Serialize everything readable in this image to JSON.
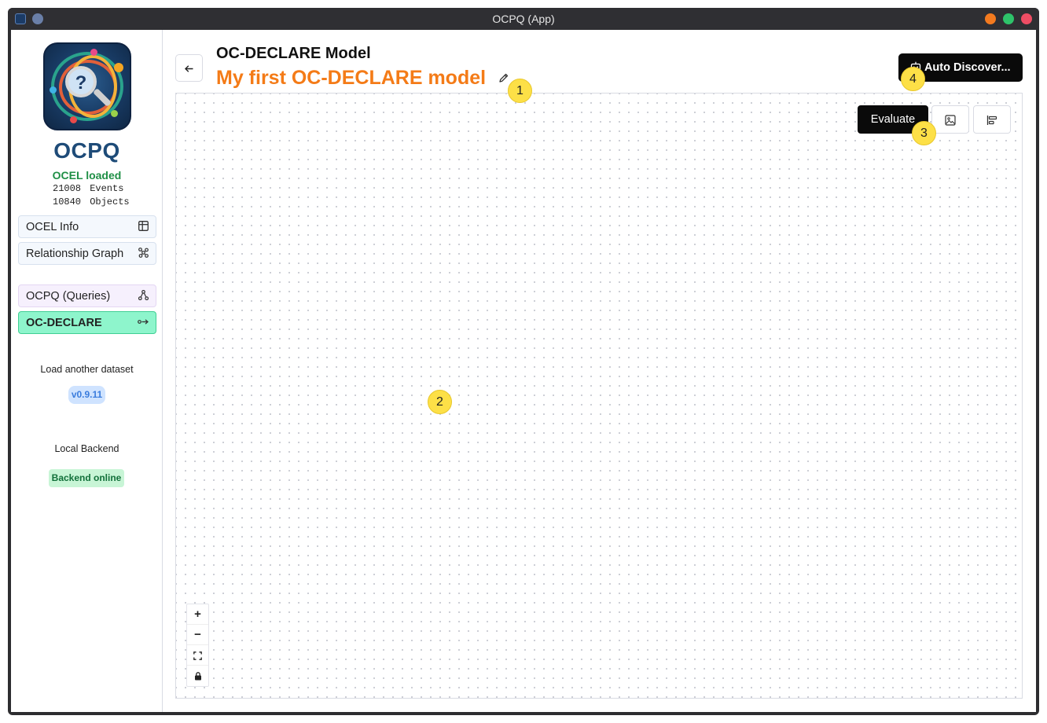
{
  "window": {
    "title": "OCPQ (App)"
  },
  "sidebar": {
    "brand": "OCPQ",
    "ocel_status": "OCEL loaded",
    "stats": [
      {
        "value": "21008",
        "label": "Events"
      },
      {
        "value": "10840",
        "label": "Objects"
      }
    ],
    "nav": [
      {
        "label": "OCEL Info",
        "icon": "table-icon"
      },
      {
        "label": "Relationship Graph",
        "icon": "graph-icon"
      },
      {
        "label": "OCPQ (Queries)",
        "icon": "query-icon"
      },
      {
        "label": "OC-DECLARE",
        "icon": "arrow-link-icon",
        "active": true
      }
    ],
    "load_another": "Load another dataset",
    "version": "v0.9.11",
    "backend_label": "Local Backend",
    "backend_status": "Backend online"
  },
  "main": {
    "heading": "OC-DECLARE Model",
    "model_name": "My first OC-DECLARE model",
    "auto_discover_label": "Auto Discover...",
    "evaluate_label": "Evaluate"
  },
  "markers": [
    "1",
    "2",
    "3",
    "4"
  ],
  "colors": {
    "accent_orange": "#f47b17",
    "active_nav": "#8ef5cc",
    "primary_button": "#0a0a0a"
  }
}
